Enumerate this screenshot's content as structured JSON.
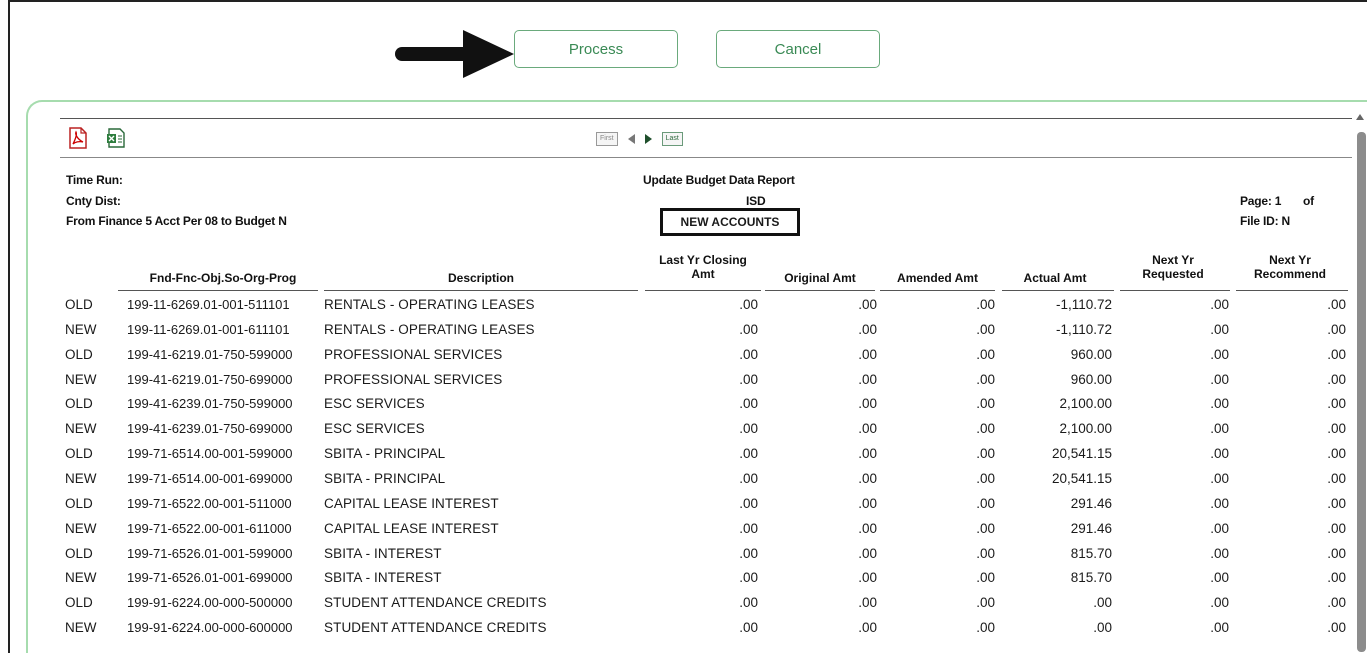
{
  "buttons": {
    "process_label": "Process",
    "cancel_label": "Cancel"
  },
  "icons": {
    "pdf": "pdf-export-icon",
    "excel": "excel-export-icon",
    "arrow": "arrow-right-icon"
  },
  "pager": {
    "first": "First",
    "last": "Last"
  },
  "report": {
    "time_run_label": "Time Run:",
    "cnty_dist_label": "Cnty Dist:",
    "from_label": "From Finance 5 Acct Per 08 to Budget N",
    "title": "Update Budget Data Report",
    "district": "ISD",
    "section": "NEW ACCOUNTS",
    "page_label": "Page: 1",
    "of_label": "of",
    "file_id": "File ID: N"
  },
  "columns": {
    "account": "Fnd-Fnc-Obj.So-Org-Prog",
    "description": "Description",
    "last_yr_line1": "Last Yr  Closing",
    "last_yr_line2": "Amt",
    "original": "Original Amt",
    "amended": "Amended Amt",
    "actual": "Actual Amt",
    "next_req_line1": "Next Yr",
    "next_req_line2": "Requested",
    "next_rec_line1": "Next Yr",
    "next_rec_line2": "Recommend"
  },
  "rows": [
    {
      "type": "OLD",
      "account": "199-11-6269.01-001-511101",
      "description": "RENTALS - OPERATING LEASES",
      "last_yr": ".00",
      "original": ".00",
      "amended": ".00",
      "actual": "-1,110.72",
      "next_req": ".00",
      "next_rec": ".00"
    },
    {
      "type": "NEW",
      "account": "199-11-6269.01-001-611101",
      "description": "RENTALS - OPERATING LEASES",
      "last_yr": ".00",
      "original": ".00",
      "amended": ".00",
      "actual": "-1,110.72",
      "next_req": ".00",
      "next_rec": ".00"
    },
    {
      "type": "OLD",
      "account": "199-41-6219.01-750-599000",
      "description": "PROFESSIONAL SERVICES",
      "last_yr": ".00",
      "original": ".00",
      "amended": ".00",
      "actual": "960.00",
      "next_req": ".00",
      "next_rec": ".00"
    },
    {
      "type": "NEW",
      "account": "199-41-6219.01-750-699000",
      "description": "PROFESSIONAL SERVICES",
      "last_yr": ".00",
      "original": ".00",
      "amended": ".00",
      "actual": "960.00",
      "next_req": ".00",
      "next_rec": ".00"
    },
    {
      "type": "OLD",
      "account": "199-41-6239.01-750-599000",
      "description": "ESC SERVICES",
      "last_yr": ".00",
      "original": ".00",
      "amended": ".00",
      "actual": "2,100.00",
      "next_req": ".00",
      "next_rec": ".00"
    },
    {
      "type": "NEW",
      "account": "199-41-6239.01-750-699000",
      "description": "ESC SERVICES",
      "last_yr": ".00",
      "original": ".00",
      "amended": ".00",
      "actual": "2,100.00",
      "next_req": ".00",
      "next_rec": ".00"
    },
    {
      "type": "OLD",
      "account": "199-71-6514.00-001-599000",
      "description": "SBITA - PRINCIPAL",
      "last_yr": ".00",
      "original": ".00",
      "amended": ".00",
      "actual": "20,541.15",
      "next_req": ".00",
      "next_rec": ".00"
    },
    {
      "type": "NEW",
      "account": "199-71-6514.00-001-699000",
      "description": "SBITA - PRINCIPAL",
      "last_yr": ".00",
      "original": ".00",
      "amended": ".00",
      "actual": "20,541.15",
      "next_req": ".00",
      "next_rec": ".00"
    },
    {
      "type": "OLD",
      "account": "199-71-6522.00-001-511000",
      "description": "CAPITAL LEASE INTEREST",
      "last_yr": ".00",
      "original": ".00",
      "amended": ".00",
      "actual": "291.46",
      "next_req": ".00",
      "next_rec": ".00"
    },
    {
      "type": "NEW",
      "account": "199-71-6522.00-001-611000",
      "description": "CAPITAL LEASE INTEREST",
      "last_yr": ".00",
      "original": ".00",
      "amended": ".00",
      "actual": "291.46",
      "next_req": ".00",
      "next_rec": ".00"
    },
    {
      "type": "OLD",
      "account": "199-71-6526.01-001-599000",
      "description": "SBITA - INTEREST",
      "last_yr": ".00",
      "original": ".00",
      "amended": ".00",
      "actual": "815.70",
      "next_req": ".00",
      "next_rec": ".00"
    },
    {
      "type": "NEW",
      "account": "199-71-6526.01-001-699000",
      "description": "SBITA - INTEREST",
      "last_yr": ".00",
      "original": ".00",
      "amended": ".00",
      "actual": "815.70",
      "next_req": ".00",
      "next_rec": ".00"
    },
    {
      "type": "OLD",
      "account": "199-91-6224.00-000-500000",
      "description": "STUDENT ATTENDANCE CREDITS",
      "last_yr": ".00",
      "original": ".00",
      "amended": ".00",
      "actual": ".00",
      "next_req": ".00",
      "next_rec": ".00"
    },
    {
      "type": "NEW",
      "account": "199-91-6224.00-000-600000",
      "description": "STUDENT ATTENDANCE CREDITS",
      "last_yr": ".00",
      "original": ".00",
      "amended": ".00",
      "actual": ".00",
      "next_req": ".00",
      "next_rec": ".00"
    }
  ]
}
